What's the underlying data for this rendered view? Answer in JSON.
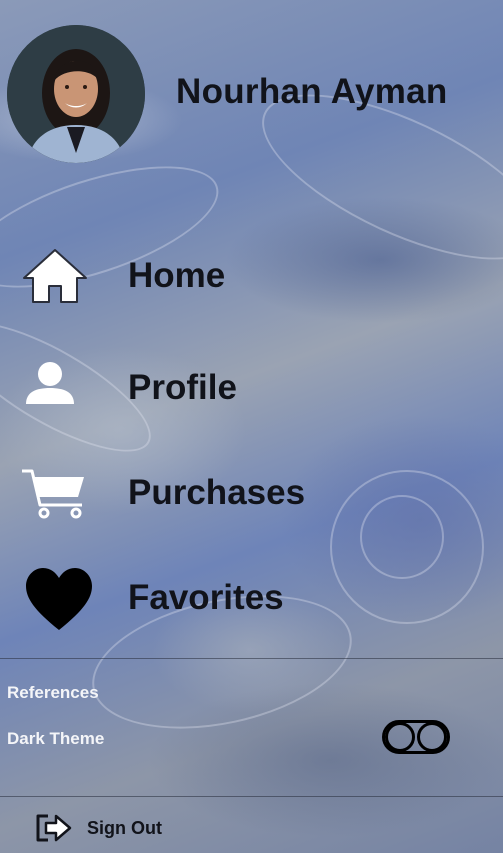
{
  "header": {
    "user_name": "Nourhan Ayman",
    "avatar_icon": "profile-photo"
  },
  "menu": {
    "items": [
      {
        "label": "Home",
        "icon": "home-icon"
      },
      {
        "label": "Profile",
        "icon": "person-icon"
      },
      {
        "label": "Purchases",
        "icon": "cart-icon"
      },
      {
        "label": "Favorites",
        "icon": "heart-icon"
      }
    ]
  },
  "settings": {
    "references_label": "References",
    "dark_theme_label": "Dark Theme",
    "dark_theme_enabled": false
  },
  "footer": {
    "signout_label": "Sign Out",
    "signout_icon": "sign-out-icon"
  },
  "colors": {
    "text": "#11131a",
    "light_text": "#f4f5f8"
  }
}
